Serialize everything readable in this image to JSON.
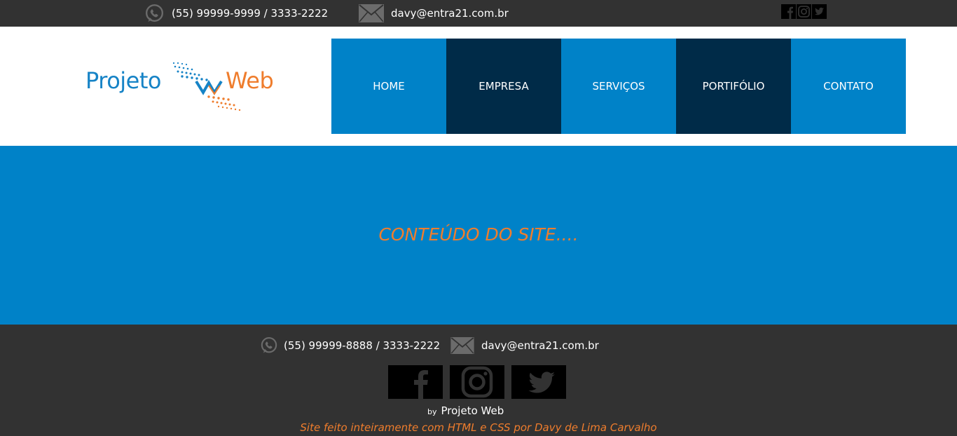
{
  "topbar": {
    "phone": "(55) 99999-9999 / 3333-2222",
    "email": "davy@entra21.com.br",
    "phone_icon": "whatsapp-icon",
    "email_icon": "envelope-icon",
    "social_icons": [
      "facebook-icon",
      "instagram-icon",
      "twitter-icon"
    ]
  },
  "header": {
    "logo_left": "Projeto",
    "logo_right": "Web"
  },
  "nav": {
    "items": [
      {
        "label": "HOME"
      },
      {
        "label": "EMPRESA"
      },
      {
        "label": "SERVIÇOS"
      },
      {
        "label": "PORTIFÓLIO"
      },
      {
        "label": "CONTATO"
      }
    ]
  },
  "main": {
    "text": "CONTEÚDO DO SITE...."
  },
  "footer": {
    "phone": "(55) 99999-8888 / 3333-2222",
    "email": "davy@entra21.com.br",
    "by_label": "by",
    "by_logo": "Projeto Web",
    "credit": "Site feito inteiramente com HTML e CSS por Davy de Lima Carvalho"
  },
  "colors": {
    "dark_bar": "#323232",
    "accent_blue": "#0082c8",
    "dark_blue": "#002b48",
    "accent_orange": "#ef7d2d"
  }
}
